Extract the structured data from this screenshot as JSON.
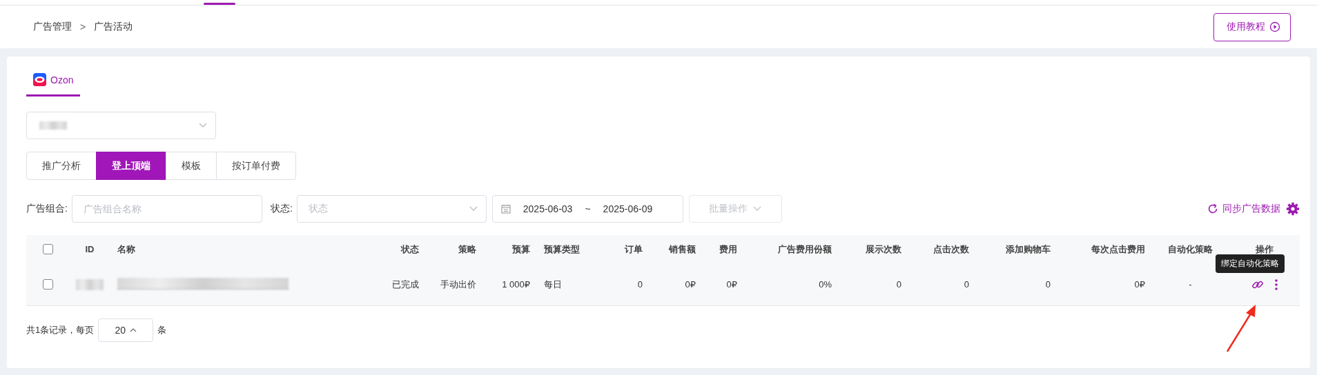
{
  "breadcrumb": {
    "items": [
      "广告管理",
      "广告活动"
    ],
    "separator": ">"
  },
  "tutorial_button": {
    "label": "使用教程"
  },
  "platform_tabs": [
    {
      "label": "Ozon",
      "selected": true
    }
  ],
  "view_tabs": [
    {
      "label": "推广分析",
      "selected": false
    },
    {
      "label": "登上顶端",
      "selected": true
    },
    {
      "label": "模板",
      "selected": false
    },
    {
      "label": "按订单付费",
      "selected": false
    }
  ],
  "filters": {
    "ad_group_label": "广告组合:",
    "ad_group_placeholder": "广告组合名称",
    "status_label": "状态:",
    "status_placeholder": "状态",
    "date_start": "2025-06-03",
    "date_separator": "~",
    "date_end": "2025-06-09",
    "bulk_button": {
      "label": "批量操作",
      "disabled": true
    }
  },
  "sync_link": "同步广告数据",
  "table": {
    "header_checked": false,
    "columns": [
      "ID",
      "名称",
      "状态",
      "策略",
      "预算",
      "预算类型",
      "订单",
      "销售额",
      "费用",
      "广告费用份额",
      "展示次数",
      "点击次数",
      "添加购物车",
      "每次点击费用",
      "自动化策略",
      "操作"
    ],
    "rows": [
      {
        "checked": false,
        "cells": [
          "",
          "",
          "已完成",
          "手动出价",
          "1 000₽",
          "每日",
          "0",
          "0₽",
          "0₽",
          "0%",
          "0",
          "0",
          "0",
          "0₽",
          "-"
        ],
        "tooltip": "绑定自动化策略"
      }
    ]
  },
  "pagination": {
    "summary": "共1条记录，每页",
    "page_size": "20",
    "unit": "条"
  }
}
